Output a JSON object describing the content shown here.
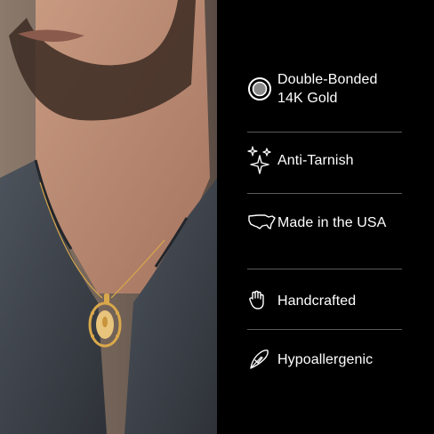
{
  "features": [
    {
      "icon": "circle-ring-icon",
      "label": "Double-Bonded 14K Gold"
    },
    {
      "icon": "sparkles-icon",
      "label": "Anti-Tarnish"
    },
    {
      "icon": "usa-map-icon",
      "label": "Made in the USA"
    },
    {
      "icon": "hand-icon",
      "label": "Handcrafted"
    },
    {
      "icon": "feather-check-icon",
      "label": "Hypoallergenic"
    }
  ],
  "colors": {
    "panel_bg": "#000000",
    "text": "#ffffff",
    "divider": "#5a5a5a",
    "pendant_gold": "#d9a84a"
  }
}
